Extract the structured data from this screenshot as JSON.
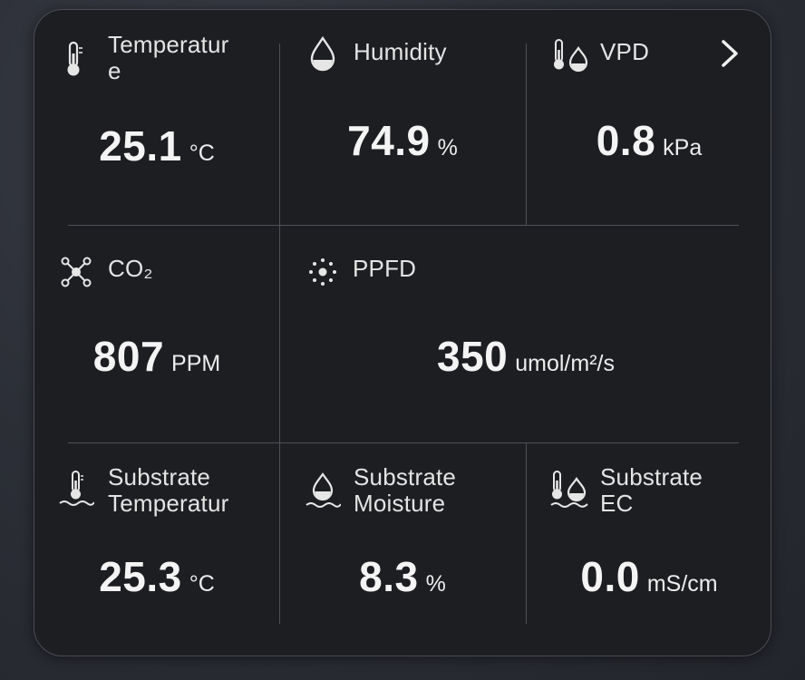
{
  "nav": {
    "next_icon": "chevron-right-icon"
  },
  "sensors": {
    "temperature": {
      "title": "Temperatur\ne",
      "value": "25.1",
      "unit": "°C",
      "icon": "thermometer-icon"
    },
    "humidity": {
      "title": "Humidity",
      "value": "74.9",
      "unit": "%",
      "icon": "droplet-icon"
    },
    "vpd": {
      "title": "VPD",
      "value": "0.8",
      "unit": "kPa",
      "icon": "thermometer-droplet-icon"
    },
    "co2": {
      "title": "CO₂",
      "value": "807",
      "unit": "PPM",
      "icon": "molecule-icon"
    },
    "ppfd": {
      "title": "PPFD",
      "value": "350",
      "unit": "umol/m²/s",
      "icon": "light-dots-icon"
    },
    "substrate_temperature": {
      "title": "Substrate\nTemperatur",
      "value": "25.3",
      "unit": "°C",
      "icon": "substrate-thermometer-icon"
    },
    "substrate_moisture": {
      "title": "Substrate\nMoisture",
      "value": "8.3",
      "unit": "%",
      "icon": "substrate-droplet-icon"
    },
    "substrate_ec": {
      "title": "Substrate\nEC",
      "value": "0.0",
      "unit": "mS/cm",
      "icon": "substrate-thermometer-droplet-icon"
    }
  },
  "colors": {
    "card_bg": "#1d1e22",
    "divider": "#4e5056",
    "text": "#ececec"
  }
}
